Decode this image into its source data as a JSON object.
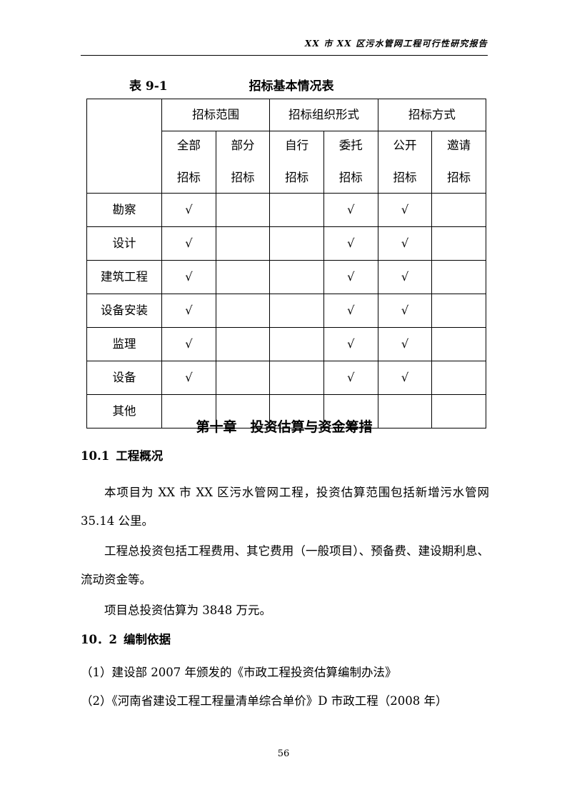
{
  "header": {
    "running_title": "XX 市 XX 区污水管网工程可行性研究报告"
  },
  "table_caption": {
    "number": "表 9-1",
    "title": "招标基本情况表"
  },
  "table": {
    "corner_label": "",
    "group_headers": [
      {
        "label": "招标范围",
        "span": 2
      },
      {
        "label": "招标组织形式",
        "span": 2
      },
      {
        "label": "招标方式",
        "span": 2
      }
    ],
    "sub_headers": [
      {
        "line1": "全部",
        "line2": "招标"
      },
      {
        "line1": "部分",
        "line2": "招标"
      },
      {
        "line1": "自行",
        "line2": "招标"
      },
      {
        "line1": "委托",
        "line2": "招标"
      },
      {
        "line1": "公开",
        "line2": "招标"
      },
      {
        "line1": "邀请",
        "line2": "招标"
      }
    ],
    "check_symbol": "√",
    "rows": [
      {
        "label": "勘察",
        "cells": [
          "√",
          "",
          "",
          "√",
          "√",
          ""
        ]
      },
      {
        "label": "设计",
        "cells": [
          "√",
          "",
          "",
          "√",
          "√",
          ""
        ]
      },
      {
        "label": "建筑工程",
        "cells": [
          "√",
          "",
          "",
          "√",
          "√",
          ""
        ]
      },
      {
        "label": "设备安装",
        "cells": [
          "√",
          "",
          "",
          "√",
          "√",
          ""
        ]
      },
      {
        "label": "监理",
        "cells": [
          "√",
          "",
          "",
          "√",
          "√",
          ""
        ]
      },
      {
        "label": "设备",
        "cells": [
          "√",
          "",
          "",
          "√",
          "√",
          ""
        ]
      },
      {
        "label": "其他",
        "cells": [
          "",
          "",
          "",
          "",
          "",
          ""
        ]
      }
    ]
  },
  "chapter": {
    "title": "第十章　投资估算与资金筹措"
  },
  "sections": [
    {
      "number": "10.1",
      "title": "工程概况",
      "paragraphs": [
        "本项目为 XX 市 XX 区污水管网工程，投资估算范围包括新增污水管网 35.14 公里。",
        "工程总投资包括工程费用、其它费用（一般项目）、预备费、建设期利息、流动资金等。",
        "项目总投资估算为 3848 万元。"
      ]
    },
    {
      "number": "10．2",
      "title": "编制依据",
      "paragraphs": [
        "（1）建设部 2007 年颁发的《市政工程投资估算编制办法》",
        "（2）《河南省建设工程工程量清单综合单价》D 市政工程（2008 年）"
      ]
    }
  ],
  "footer": {
    "page_number": "56"
  }
}
